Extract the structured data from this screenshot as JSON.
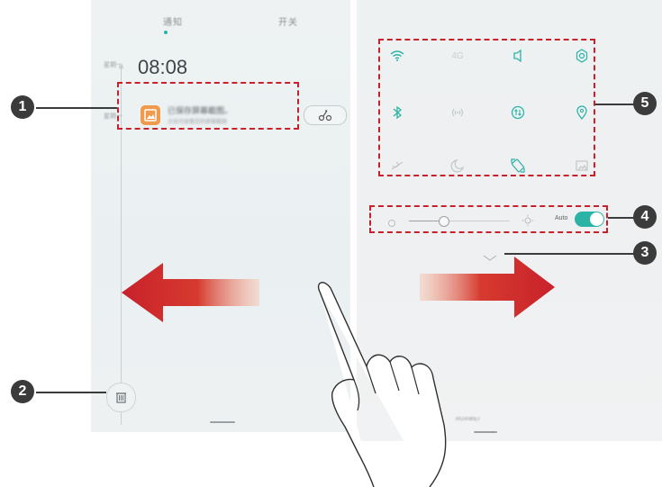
{
  "left_screen": {
    "tabs": [
      {
        "label": "通知"
      },
      {
        "label": "开关"
      }
    ],
    "timeline_labels": {
      "top": "星期一",
      "mid": "星期一"
    },
    "time": "08:08",
    "notification": {
      "title": "已保存屏幕截图。",
      "subtitle": "点击可查看您的屏幕截图"
    }
  },
  "right_screen": {
    "toggles": [
      {
        "icon": "wifi-icon",
        "active": true
      },
      {
        "icon": "mobile-data-icon",
        "label": "4G",
        "active": false
      },
      {
        "icon": "sound-icon",
        "active": true
      },
      {
        "icon": "settings-icon",
        "active": true
      },
      {
        "icon": "bluetooth-icon",
        "active": true
      },
      {
        "icon": "hotspot-icon",
        "active": false
      },
      {
        "icon": "data-sync-icon",
        "active": true
      },
      {
        "icon": "location-icon",
        "active": true
      },
      {
        "icon": "airplane-mode-icon",
        "active": false
      },
      {
        "icon": "eye-comfort-icon",
        "active": false
      },
      {
        "icon": "auto-rotate-icon",
        "active": true
      },
      {
        "icon": "screenshot-icon",
        "active": false
      }
    ],
    "brightness": {
      "level": 0.35,
      "auto_label": "Auto",
      "auto_on": true
    },
    "footer": "HUAWEI"
  },
  "callouts": [
    "1",
    "2",
    "3",
    "4",
    "5"
  ],
  "colors": {
    "accent": "#2bb3a6",
    "callout_red": "#c8212b",
    "arrow_red": "#c8212b"
  }
}
